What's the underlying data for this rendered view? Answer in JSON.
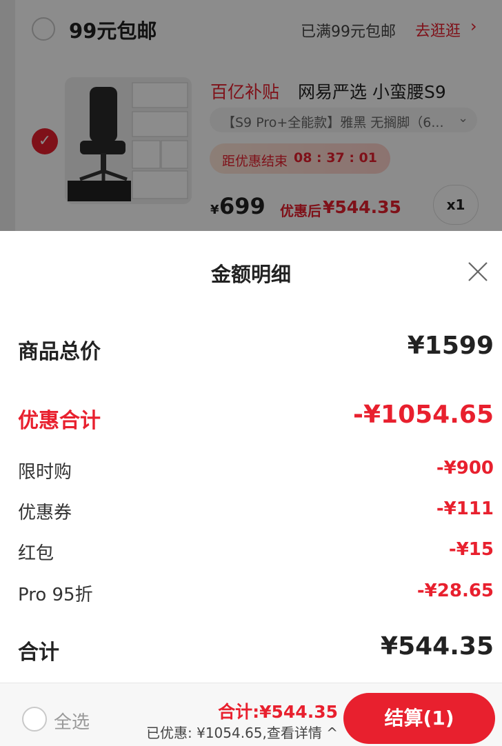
{
  "cart": {
    "shop_title": "99元包邮",
    "shop_note": "已满99元包邮",
    "shop_link": "去逛逛",
    "shop_link_arrow": "›",
    "item": {
      "subsidy_tag": "百亿补贴",
      "title": "网易严选 小蛮腰S9",
      "sku": "【S9 Pro+全能款】雅黑 无搁脚（6...",
      "countdown_label": "距优惠结束",
      "countdown_time": "08 : 37 : 01",
      "price_symbol": "¥",
      "price": "699",
      "after_label": "优惠后",
      "after_price": "¥544.35",
      "quantity": "x1",
      "selected": true
    }
  },
  "sheet": {
    "title": "金额明细",
    "rows": [
      {
        "label": "商品总价",
        "value": "¥1599"
      },
      {
        "label": "优惠合计",
        "value": "-¥1054.65"
      },
      {
        "label": "限时购",
        "value": "-¥900"
      },
      {
        "label": "优惠券",
        "value": "-¥111"
      },
      {
        "label": "红包",
        "value": "-¥15"
      },
      {
        "label": "Pro 95折",
        "value": "-¥28.65"
      },
      {
        "label": "合计",
        "value": "¥544.35"
      }
    ]
  },
  "bottom_bar": {
    "select_all_label": "全选",
    "total": "合计:¥544.35",
    "saved_detail": "已优惠: ¥1054.65,查看详情 ^",
    "checkout_label": "结算(1)"
  },
  "colors": {
    "accent": "#e8202e",
    "text": "#222222",
    "overlay": "rgba(0,0,0,0.45)"
  }
}
